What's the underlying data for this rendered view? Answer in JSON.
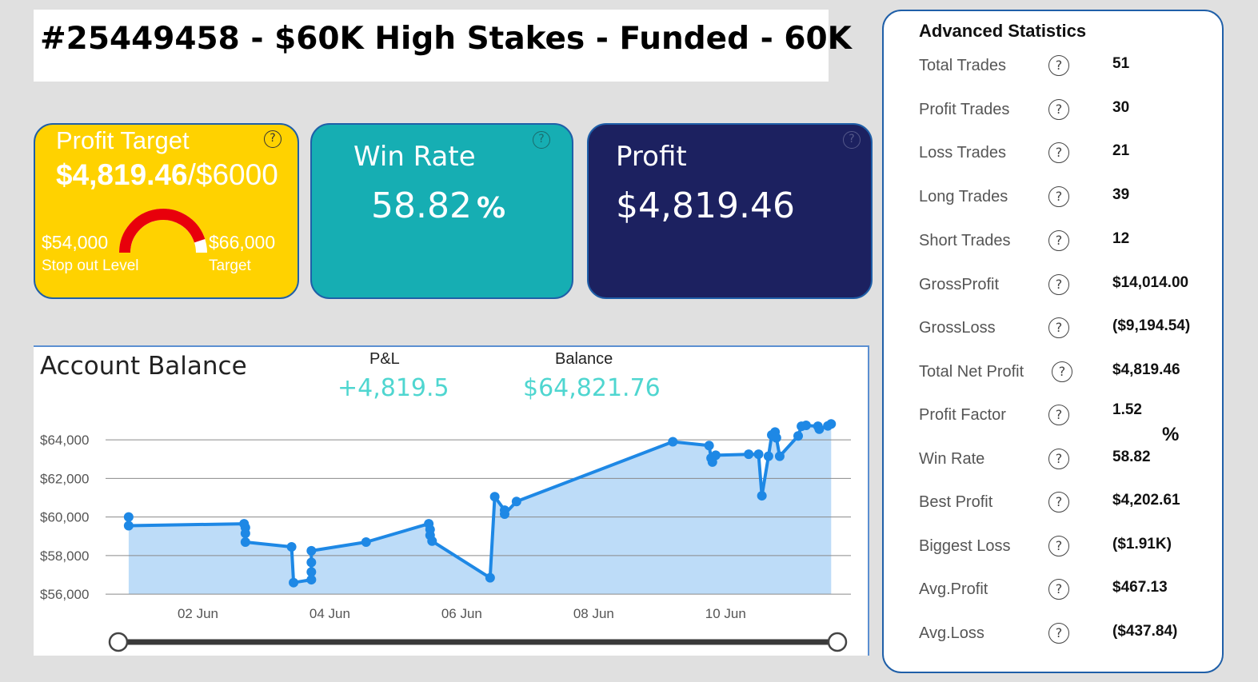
{
  "header": {
    "title": "#25449458 - $60K High Stakes - Funded - 60K"
  },
  "cards": {
    "profit_target": {
      "title": "Profit Target",
      "current": "$4,819.46",
      "separator": "/",
      "goal": "$6000",
      "stop_out_value": "$54,000",
      "stop_out_label": "Stop out Level",
      "target_value": "$66,000",
      "target_label": "Target",
      "gauge_fraction": 0.9,
      "help": "?"
    },
    "win_rate": {
      "title": "Win Rate",
      "value": "58.82",
      "unit": "%",
      "help": "?"
    },
    "profit": {
      "title": "Profit",
      "value": "$4,819.46",
      "help": "?"
    }
  },
  "chart": {
    "title": "Account Balance",
    "pnl_label": "P&L",
    "pnl_value": "+4,819.5",
    "balance_label": "Balance",
    "balance_value": "$64,821.76"
  },
  "chart_data": {
    "type": "area",
    "title": "Account Balance",
    "xlabel": "",
    "ylabel": "",
    "x_ticks": [
      "02 Jun",
      "04 Jun",
      "06 Jun",
      "08 Jun",
      "10 Jun"
    ],
    "x_tick_days": [
      2,
      4,
      6,
      8,
      10
    ],
    "y_ticks": [
      "$56,000",
      "$58,000",
      "$60,000",
      "$62,000",
      "$64,000"
    ],
    "y_tick_values": [
      56000,
      58000,
      60000,
      62000,
      64000
    ],
    "ylim": [
      55800,
      64500
    ],
    "xlim": [
      0.6,
      11.9
    ],
    "grid": true,
    "color": "#1e88e5",
    "fill": "#bddcf8",
    "points": [
      [
        0.95,
        60000
      ],
      [
        0.95,
        59550
      ],
      [
        2.7,
        59650
      ],
      [
        2.72,
        59450
      ],
      [
        2.72,
        59150
      ],
      [
        2.72,
        58700
      ],
      [
        3.42,
        58450
      ],
      [
        3.45,
        56600
      ],
      [
        3.72,
        56750
      ],
      [
        3.72,
        57150
      ],
      [
        3.72,
        57650
      ],
      [
        3.72,
        58250
      ],
      [
        4.55,
        58700
      ],
      [
        5.5,
        59650
      ],
      [
        5.52,
        59350
      ],
      [
        5.52,
        59050
      ],
      [
        5.55,
        58750
      ],
      [
        6.43,
        56850
      ],
      [
        6.5,
        61050
      ],
      [
        6.65,
        60350
      ],
      [
        6.65,
        60150
      ],
      [
        6.83,
        60800
      ],
      [
        9.2,
        63900
      ],
      [
        9.75,
        63700
      ],
      [
        9.78,
        63050
      ],
      [
        9.8,
        62850
      ],
      [
        9.85,
        63200
      ],
      [
        10.35,
        63250
      ],
      [
        10.5,
        63250
      ],
      [
        10.55,
        61100
      ],
      [
        10.65,
        63150
      ],
      [
        10.7,
        64250
      ],
      [
        10.75,
        64400
      ],
      [
        10.77,
        64100
      ],
      [
        10.82,
        63150
      ],
      [
        11.1,
        64200
      ],
      [
        11.15,
        64700
      ],
      [
        11.22,
        64750
      ],
      [
        11.4,
        64700
      ],
      [
        11.42,
        64550
      ],
      [
        11.55,
        64720
      ],
      [
        11.6,
        64820
      ]
    ]
  },
  "stats": {
    "title": "Advanced Statistics",
    "help": "?",
    "percent_sign": "%",
    "rows": [
      {
        "label": "Total Trades",
        "value": "51"
      },
      {
        "label": "Profit Trades",
        "value": "30"
      },
      {
        "label": "Loss Trades",
        "value": "21"
      },
      {
        "label": "Long Trades",
        "value": "39"
      },
      {
        "label": "Short Trades",
        "value": "12"
      },
      {
        "label": "GrossProfit",
        "value": "$14,014.00"
      },
      {
        "label": "GrossLoss",
        "value": "($9,194.54)"
      },
      {
        "label": "Total Net Profit",
        "value": "$4,819.46"
      },
      {
        "label": "Profit Factor",
        "value": "1.52"
      },
      {
        "label": "Win Rate",
        "value": "58.82"
      },
      {
        "label": "Best Profit",
        "value": "$4,202.61"
      },
      {
        "label": "Biggest Loss",
        "value": "($1.91K)"
      },
      {
        "label": "Avg.Profit",
        "value": "$467.13"
      },
      {
        "label": "Avg.Loss",
        "value": "($437.84)"
      }
    ]
  }
}
